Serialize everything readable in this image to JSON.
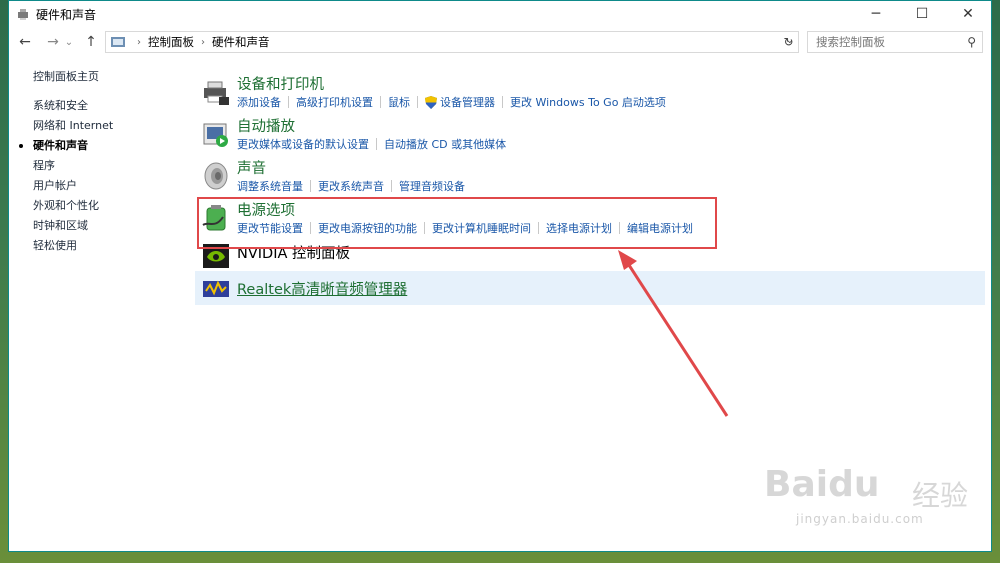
{
  "window": {
    "title": "硬件和声音",
    "controls": {
      "minimize": "─",
      "maximize": "☐",
      "close": "✕"
    }
  },
  "nav": {
    "back": "←",
    "forward": "→",
    "history": "⌄",
    "up": "↑",
    "breadcrumbs": [
      "控制面板",
      "硬件和声音"
    ],
    "refresh": "↻",
    "dropdown": "⌄"
  },
  "search": {
    "placeholder": "搜索控制面板",
    "icon": "search-icon"
  },
  "sidebar": {
    "items": [
      {
        "label": "控制面板主页",
        "active": false
      },
      {
        "label": "系统和安全",
        "active": false
      },
      {
        "label": "网络和 Internet",
        "active": false
      },
      {
        "label": "硬件和声音",
        "active": true
      },
      {
        "label": "程序",
        "active": false
      },
      {
        "label": "用户帐户",
        "active": false
      },
      {
        "label": "外观和个性化",
        "active": false
      },
      {
        "label": "时钟和区域",
        "active": false
      },
      {
        "label": "轻松使用",
        "active": false
      }
    ]
  },
  "categories": {
    "devices": {
      "title": "设备和打印机",
      "links": [
        "添加设备",
        "高级打印机设置",
        "鼠标",
        "设备管理器",
        "更改 Windows To Go 启动选项"
      ]
    },
    "autoplay": {
      "title": "自动播放",
      "links": [
        "更改媒体或设备的默认设置",
        "自动播放 CD 或其他媒体"
      ]
    },
    "sound": {
      "title": "声音",
      "links": [
        "调整系统音量",
        "更改系统声音",
        "管理音频设备"
      ]
    },
    "power": {
      "title": "电源选项",
      "links": [
        "更改节能设置",
        "更改电源按钮的功能",
        "更改计算机睡眠时间",
        "选择电源计划",
        "编辑电源计划"
      ]
    },
    "nvidia": {
      "title": "NVIDIA 控制面板"
    },
    "realtek": {
      "title": "Realtek高清晰音频管理器"
    }
  },
  "watermark": {
    "logo": "Baidu",
    "cn": "经验",
    "url": "jingyan.baidu.com"
  },
  "colors": {
    "category_title": "#1e6f33",
    "link": "#1a57a8",
    "highlight": "#e0484a",
    "selected_row": "#e6f1fb"
  }
}
